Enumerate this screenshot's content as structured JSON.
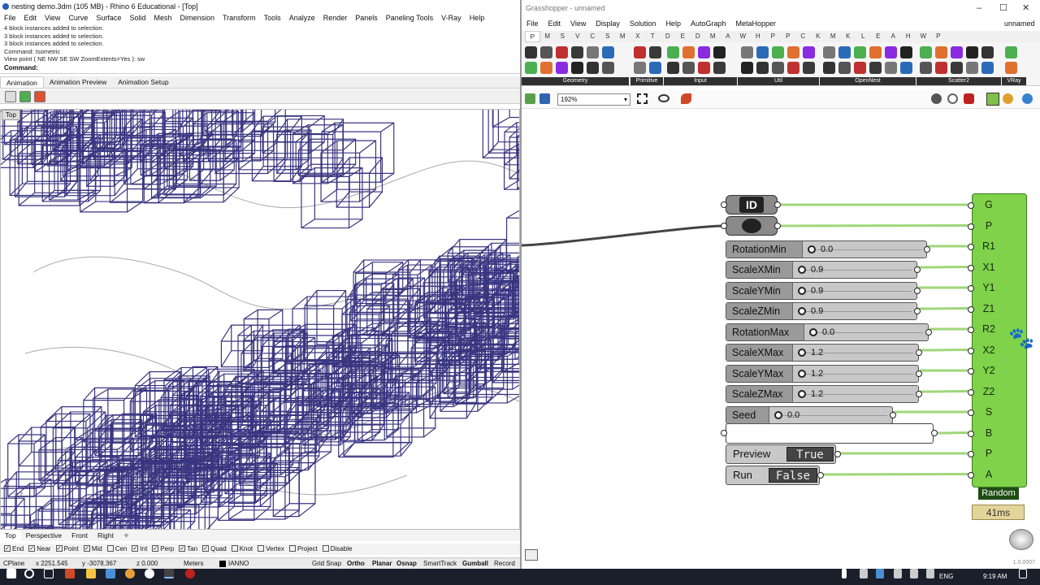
{
  "rhino": {
    "title": "nesting demo.3dm (105 MB) - Rhino 6 Educational - [Top]",
    "menu": [
      "File",
      "Edit",
      "View",
      "Curve",
      "Surface",
      "Solid",
      "Mesh",
      "Dimension",
      "Transform",
      "Tools",
      "Analyze",
      "Render",
      "Panels",
      "Paneling Tools",
      "V-Ray",
      "Help"
    ],
    "history": [
      "4 block instances added to selection.",
      "3 block instances added to selection.",
      "3 block instances added to selection.",
      "Command: Isometric",
      "View point ( NE  NW  SE  SW  ZoomExtents=Yes ): sw"
    ],
    "command_label": "Command:",
    "anim_tabs": [
      "Animation",
      "Animation Preview",
      "Animation Setup"
    ],
    "viewport_label": "Top",
    "viewport_tabs": [
      "Top",
      "Perspective",
      "Front",
      "Right"
    ],
    "osnaps": [
      {
        "label": "End",
        "checked": true
      },
      {
        "label": "Near",
        "checked": true
      },
      {
        "label": "Point",
        "checked": true
      },
      {
        "label": "Mid",
        "checked": true
      },
      {
        "label": "Cen",
        "checked": false
      },
      {
        "label": "Int",
        "checked": true
      },
      {
        "label": "Perp",
        "checked": true
      },
      {
        "label": "Tan",
        "checked": true
      },
      {
        "label": "Quad",
        "checked": true
      },
      {
        "label": "Knot",
        "checked": false
      },
      {
        "label": "Vertex",
        "checked": false
      },
      {
        "label": "Project",
        "checked": false
      },
      {
        "label": "Disable",
        "checked": false
      }
    ],
    "status": {
      "cplane": "CPlane",
      "x": "x 2251.545",
      "y": "y -3078.367",
      "z": "z 0.000",
      "units": "Meters",
      "layer": "IANNO",
      "grid_snap": "Grid Snap",
      "ortho": "Ortho",
      "planar": "Planar",
      "osnap": "Osnap",
      "smarttrack": "SmartTrack",
      "gumball": "Gumball",
      "record": "Record H"
    },
    "axis": "y z",
    "stub_pins": [
      "G",
      "X"
    ],
    "line_color": "#3a3580"
  },
  "gh": {
    "title": "Grasshopper - unnamed",
    "doc_name": "unnamed",
    "menu": [
      "File",
      "Edit",
      "View",
      "Display",
      "Solution",
      "Help",
      "AutoGraph",
      "MetaHopper"
    ],
    "tabs": [
      "P",
      "M",
      "S",
      "V",
      "C",
      "S",
      "M",
      "X",
      "T",
      "D",
      "E",
      "D",
      "M",
      "A",
      "W",
      "H",
      "P",
      "P",
      "C",
      "K",
      "M",
      "K",
      "L",
      "E",
      "A",
      "H",
      "W",
      "P"
    ],
    "ribbon_sections": [
      "Geometry",
      "Primitive",
      "Input",
      "Util",
      "OpenNest",
      "Scatter2",
      "VRay"
    ],
    "zoom": "192%",
    "sliders": [
      {
        "label": "RotationMin",
        "value": "0.0",
        "pin": "R1"
      },
      {
        "label": "ScaleXMin",
        "value": "0.9",
        "pin": "X1"
      },
      {
        "label": "ScaleYMin",
        "value": "0.9",
        "pin": "Y1"
      },
      {
        "label": "ScaleZMin",
        "value": "0.9",
        "pin": "Z1"
      },
      {
        "label": "RotationMax",
        "value": "0.0",
        "pin": "R2"
      },
      {
        "label": "ScaleXMax",
        "value": "1.2",
        "pin": "X2"
      },
      {
        "label": "ScaleYMax",
        "value": "1.2",
        "pin": "Y2"
      },
      {
        "label": "ScaleZMax",
        "value": "1.2",
        "pin": "Z2"
      },
      {
        "label": "Seed",
        "value": "0.0",
        "pin": "S"
      }
    ],
    "id_label": "ID",
    "toggles": [
      {
        "label": "Preview",
        "value": "True",
        "pin": "P"
      },
      {
        "label": "Run",
        "value": "False",
        "pin": "A"
      }
    ],
    "pins": [
      "G",
      "P",
      "R1",
      "X1",
      "Y1",
      "Z1",
      "R2",
      "X2",
      "Y2",
      "Z2",
      "S",
      "B",
      "P",
      "A"
    ],
    "component_name": "Random",
    "timer": "41ms",
    "version": "1.0.0007",
    "component_color": "#7fd24a",
    "wire_color": "#9fd67a"
  },
  "taskbar": {
    "lang": "ENG",
    "time": "9:19 AM"
  }
}
